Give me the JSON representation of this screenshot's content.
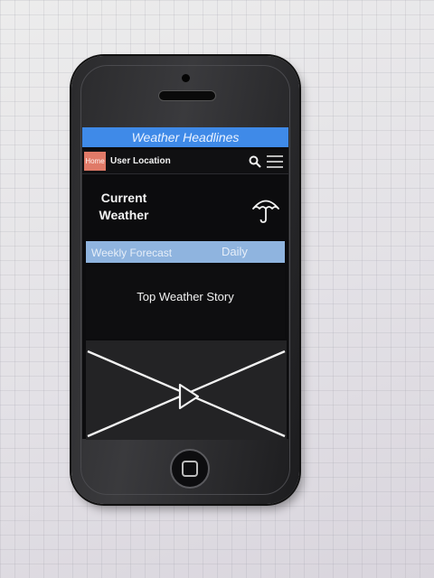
{
  "app": {
    "title": "Weather Headlines"
  },
  "nav": {
    "home_label": "Home",
    "location_label": "User Location",
    "icons": [
      "search-icon",
      "menu-icon"
    ]
  },
  "current": {
    "label": "Current Weather",
    "icon": "umbrella-icon"
  },
  "forecast": {
    "weekly_label": "Weekly Forecast",
    "daily_label": "Daily"
  },
  "story": {
    "title": "Top Weather Story"
  },
  "video": {
    "icon": "play-icon"
  },
  "colors": {
    "title_bar": "#3f8ae8",
    "home_button": "#e07a68",
    "forecast_bar": "#8fb4df"
  }
}
